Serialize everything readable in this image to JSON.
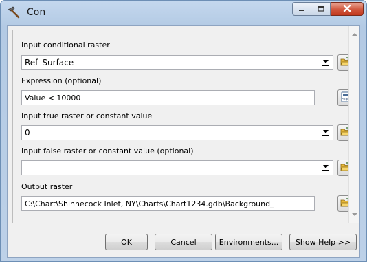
{
  "window": {
    "title": "Con",
    "icon": "hammer-icon",
    "controls": [
      "minimize-icon",
      "maximize-icon",
      "close-icon"
    ]
  },
  "form": {
    "in_conditional": {
      "label": "Input conditional raster",
      "value": "Ref_Surface",
      "browse_icon": "folder-open-icon"
    },
    "expression": {
      "label": "Expression (optional)",
      "value": "Value < 10000",
      "builder_icon": "sql-icon",
      "builder_icon_text": "SQL"
    },
    "true_value": {
      "label": "Input true raster or constant value",
      "value": "0",
      "browse_icon": "folder-open-icon"
    },
    "false_value": {
      "label": "Input false raster or constant value (optional)",
      "value": "",
      "browse_icon": "folder-open-icon"
    },
    "output": {
      "label": "Output raster",
      "value": "C:\\Chart\\Shinnecock Inlet, NY\\Charts\\Chart1234.gdb\\Background_",
      "browse_icon": "folder-open-icon"
    }
  },
  "buttons": {
    "ok": "OK",
    "cancel": "Cancel",
    "environments": "Environments...",
    "show_help": "Show Help >>"
  },
  "colors": {
    "title_bg": "#c4d8ee",
    "close_button": "#c1391f",
    "client_bg": "#f0f0f0"
  }
}
